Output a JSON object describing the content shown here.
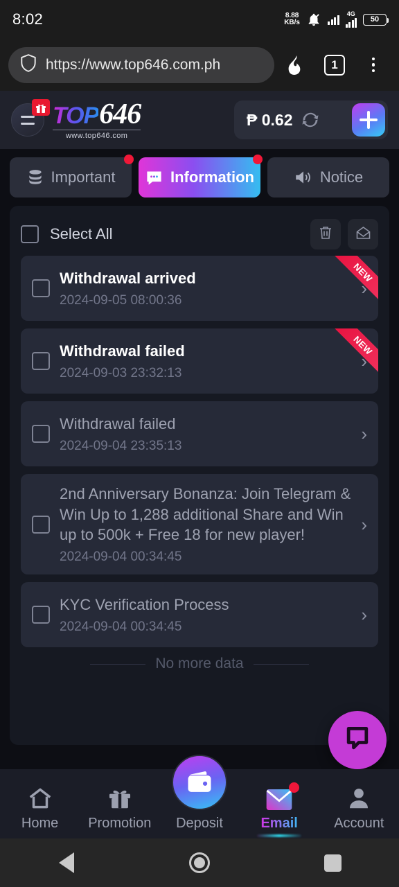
{
  "status_bar": {
    "time": "8:02",
    "net_speed_value": "8.88",
    "net_speed_unit": "KB/s",
    "mute_icon": "bell-muted-icon",
    "network_type": "4G",
    "battery_level": "50"
  },
  "browser": {
    "shield_icon": "shield-icon",
    "url": "https://www.top646.com.ph",
    "flame_icon": "flame-icon",
    "tab_count": "1",
    "menu_icon": "three-dots-icon"
  },
  "app_header": {
    "menu_icon": "hamburger-menu-icon",
    "gift_badge_icon": "gift-icon",
    "logo_primary": "TOP",
    "logo_secondary": "646",
    "logo_subtitle": "www.top646.com",
    "balance": "₱ 0.62",
    "refresh_icon": "refresh-icon",
    "deposit_plus_label": "+",
    "accent_gradient_start": "#c03df0",
    "accent_gradient_end": "#35cdf5"
  },
  "tabs": [
    {
      "label": "Important",
      "icon": "database-stack-icon",
      "active": false,
      "badge": true
    },
    {
      "label": "Information",
      "icon": "chat-bubble-icon",
      "active": true,
      "badge": true
    },
    {
      "label": "Notice",
      "icon": "speaker-icon",
      "active": false,
      "badge": false
    }
  ],
  "list_toolbar": {
    "select_all_label": "Select All",
    "delete_icon": "trash-icon",
    "mark_read_icon": "open-envelope-icon"
  },
  "messages": [
    {
      "title": "Withdrawal arrived",
      "date": "2024-09-05 08:00:36",
      "unread": true,
      "ribbon": "NEW"
    },
    {
      "title": "Withdrawal failed",
      "date": "2024-09-03 23:32:13",
      "unread": true,
      "ribbon": "NEW"
    },
    {
      "title": "Withdrawal failed",
      "date": "2024-09-04 23:35:13",
      "unread": false,
      "ribbon": ""
    },
    {
      "title": "2nd Anniversary Bonanza: Join Telegram & Win Up to 1,288 additional Share and Win up to 500k + Free 18 for new player!",
      "date": "2024-09-04 00:34:45",
      "unread": false,
      "ribbon": ""
    },
    {
      "title": "KYC Verification Process",
      "date": "2024-09-04 00:34:45",
      "unread": false,
      "ribbon": ""
    }
  ],
  "list_footer": {
    "no_more_label": "No more data"
  },
  "floating_chat": {
    "icon": "live-chat-icon",
    "color": "#c43bd6"
  },
  "bottom_nav": [
    {
      "label": "Home",
      "icon": "home-icon",
      "active": false,
      "badge": false
    },
    {
      "label": "Promotion",
      "icon": "gift-icon",
      "active": false,
      "badge": false
    },
    {
      "label": "Deposit",
      "icon": "wallet-icon",
      "active": false,
      "badge": false
    },
    {
      "label": "Email",
      "icon": "envelope-icon",
      "active": true,
      "badge": true
    },
    {
      "label": "Account",
      "icon": "person-icon",
      "active": false,
      "badge": false
    }
  ],
  "android_nav": {
    "back_icon": "back-triangle-icon",
    "home_icon": "home-circle-icon",
    "recents_icon": "recents-square-icon"
  }
}
